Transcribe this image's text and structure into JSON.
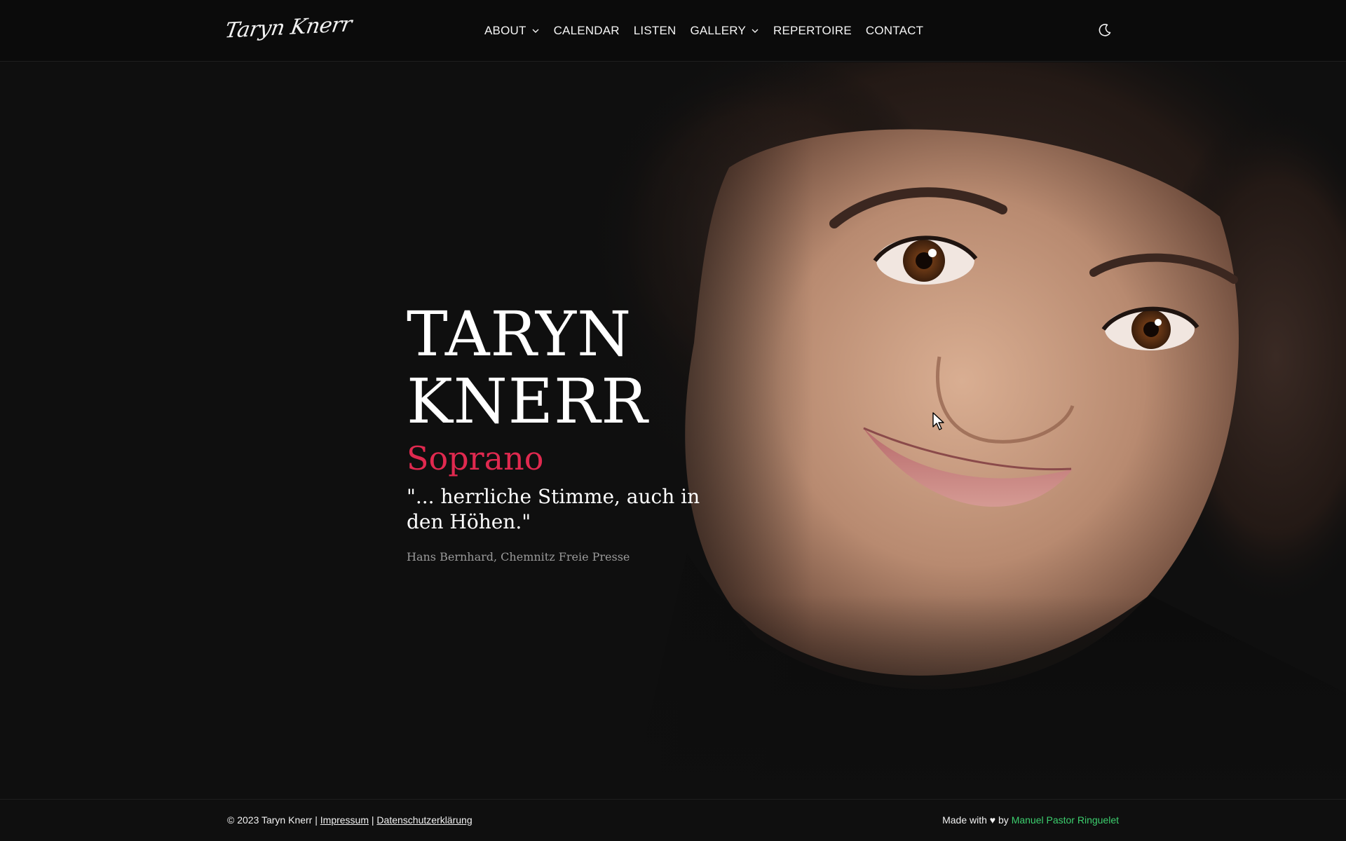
{
  "header": {
    "logo_text": "Taryn Knerr",
    "nav": [
      {
        "label": "ABOUT",
        "has_dropdown": true
      },
      {
        "label": "CALENDAR",
        "has_dropdown": false
      },
      {
        "label": "LISTEN",
        "has_dropdown": false
      },
      {
        "label": "GALLERY",
        "has_dropdown": true
      },
      {
        "label": "REPERTOIRE",
        "has_dropdown": false
      },
      {
        "label": "CONTACT",
        "has_dropdown": false
      }
    ],
    "theme_toggle_icon": "moon-icon"
  },
  "hero": {
    "name_line1": "TARYN",
    "name_line2": "KNERR",
    "voice_type": "Soprano",
    "quote": "\"... herrliche Stimme, auch in den Höhen.\"",
    "quote_source": "Hans Bernhard, Chemnitz Freie Presse",
    "accent_color": "#e0294f"
  },
  "footer": {
    "copyright": "© 2023 Taryn Knerr |",
    "impressum": "Impressum",
    "separator": "|",
    "privacy": "Datenschutzerklärung",
    "made_with_prefix": "Made with",
    "heart": "♥",
    "made_with_by": "by",
    "credit_name": "Manuel Pastor Ringuelet",
    "credit_color": "#3ccf6e"
  }
}
